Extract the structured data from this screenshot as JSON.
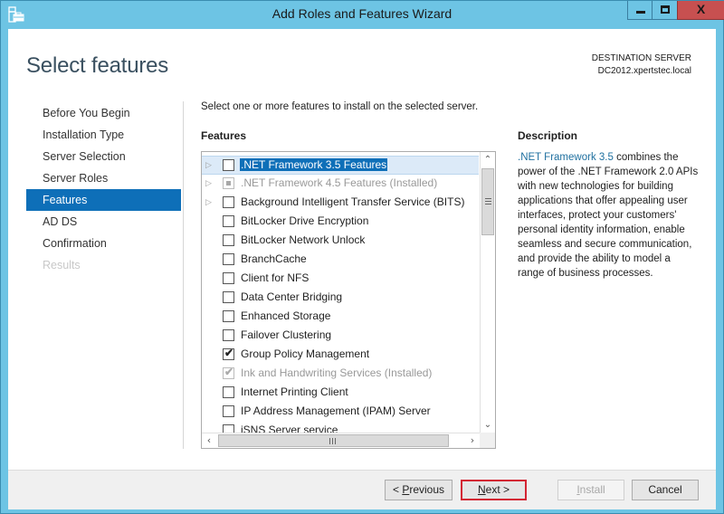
{
  "window": {
    "title": "Add Roles and Features Wizard",
    "controls": {
      "minimize": "minimize",
      "maximize": "maximize",
      "close": "X"
    }
  },
  "header": {
    "page_title": "Select features",
    "destination_label": "DESTINATION SERVER",
    "destination_server": "DC2012.xpertstec.local"
  },
  "nav": {
    "items": [
      {
        "label": "Before You Begin",
        "state": "normal"
      },
      {
        "label": "Installation Type",
        "state": "normal"
      },
      {
        "label": "Server Selection",
        "state": "normal"
      },
      {
        "label": "Server Roles",
        "state": "normal"
      },
      {
        "label": "Features",
        "state": "active"
      },
      {
        "label": "AD DS",
        "state": "normal"
      },
      {
        "label": "Confirmation",
        "state": "normal"
      },
      {
        "label": "Results",
        "state": "disabled"
      }
    ]
  },
  "main": {
    "instruction": "Select one or more features to install on the selected server.",
    "features_label": "Features",
    "features": [
      {
        "label": ".NET Framework 3.5 Features",
        "expandable": true,
        "state": "unchecked",
        "selected": true,
        "disabled": false
      },
      {
        "label": ".NET Framework 4.5 Features (Installed)",
        "expandable": true,
        "state": "partial",
        "selected": false,
        "disabled": true
      },
      {
        "label": "Background Intelligent Transfer Service (BITS)",
        "expandable": true,
        "state": "unchecked",
        "selected": false,
        "disabled": false
      },
      {
        "label": "BitLocker Drive Encryption",
        "expandable": false,
        "state": "unchecked",
        "selected": false,
        "disabled": false
      },
      {
        "label": "BitLocker Network Unlock",
        "expandable": false,
        "state": "unchecked",
        "selected": false,
        "disabled": false
      },
      {
        "label": "BranchCache",
        "expandable": false,
        "state": "unchecked",
        "selected": false,
        "disabled": false
      },
      {
        "label": "Client for NFS",
        "expandable": false,
        "state": "unchecked",
        "selected": false,
        "disabled": false
      },
      {
        "label": "Data Center Bridging",
        "expandable": false,
        "state": "unchecked",
        "selected": false,
        "disabled": false
      },
      {
        "label": "Enhanced Storage",
        "expandable": false,
        "state": "unchecked",
        "selected": false,
        "disabled": false
      },
      {
        "label": "Failover Clustering",
        "expandable": false,
        "state": "unchecked",
        "selected": false,
        "disabled": false
      },
      {
        "label": "Group Policy Management",
        "expandable": false,
        "state": "checked",
        "selected": false,
        "disabled": false
      },
      {
        "label": "Ink and Handwriting Services (Installed)",
        "expandable": false,
        "state": "checked",
        "selected": false,
        "disabled": true
      },
      {
        "label": "Internet Printing Client",
        "expandable": false,
        "state": "unchecked",
        "selected": false,
        "disabled": false
      },
      {
        "label": "IP Address Management (IPAM) Server",
        "expandable": false,
        "state": "unchecked",
        "selected": false,
        "disabled": false
      },
      {
        "label": "iSNS Server service",
        "expandable": false,
        "state": "unchecked",
        "selected": false,
        "disabled": false
      }
    ]
  },
  "description": {
    "title": "Description",
    "link_text": ".NET Framework 3.5",
    "body": " combines the power of the .NET Framework 2.0 APIs with new technologies for building applications that offer appealing user interfaces, protect your customers' personal identity information, enable seamless and secure communication, and provide the ability to model a range of business processes."
  },
  "footer": {
    "previous": {
      "prefix": "< ",
      "accel": "P",
      "rest": "revious"
    },
    "next": {
      "accel": "N",
      "rest": "ext >"
    },
    "install": {
      "accel": "I",
      "rest": "nstall"
    },
    "cancel": "Cancel"
  },
  "colors": {
    "titlebar": "#6dc4e4",
    "close_button": "#c75050",
    "accent": "#0e6fb8",
    "highlight_border": "#d32433",
    "link": "#1e6f9f"
  }
}
